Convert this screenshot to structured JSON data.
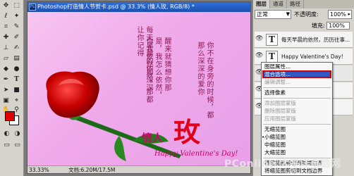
{
  "document": {
    "title": "Photoshop打造情人节贺卡.psd @ 33.3% (情人玫, RGB/8) *",
    "zoom": "33.33%",
    "doc_size": "文档:6.20M/17.5M"
  },
  "canvas": {
    "poem_col1": "每天早晨的依然，那都让你记得",
    "poem_col2": "醒来就猜想你那是，我怎么依然，你我依然那深深",
    "poem_col3": "你不在身旁的时候，都那么深深的爱你",
    "qingren": "情人",
    "mei": "玫",
    "valentine": "Happy Valentine's Day!"
  },
  "layers_panel": {
    "tabs": [
      "图层",
      "通道",
      "路径"
    ],
    "blend_mode": "正常",
    "opacity_label": "不透明度:",
    "opacity_value": "100%",
    "fill_label": "填充:",
    "fill_value": "100%",
    "layers": [
      {
        "name": "每天早晨的依然，历历往事..."
      },
      {
        "name": "Happy Valentine's Day!"
      }
    ]
  },
  "context_menu": {
    "items": [
      {
        "label": "图层属性...",
        "disabled": false
      },
      {
        "label": "混合选项...",
        "disabled": false,
        "selected": true
      },
      {
        "label": "编辑调整...",
        "disabled": true
      },
      {
        "label": "选择像素",
        "disabled": false
      },
      {
        "label": "添加图层蒙版",
        "disabled": true
      },
      {
        "label": "删除图层蒙版",
        "disabled": true
      },
      {
        "label": "应用图层蒙版",
        "disabled": true
      },
      {
        "label": "无缩览图",
        "disabled": false
      },
      {
        "label": "小缩览图",
        "disabled": false,
        "checked": true
      },
      {
        "label": "中缩览图",
        "disabled": false
      },
      {
        "label": "大缩览图",
        "disabled": false
      },
      {
        "label": "将缩览图剪切到图层边界",
        "disabled": false
      },
      {
        "label": "将缩览图剪切到文档边界",
        "disabled": false
      }
    ]
  },
  "watermark": "PConline 太平洋电脑网",
  "colors": {
    "foreground": "#e00000",
    "background": "#ffffff",
    "highlight": "#2f57c2",
    "annotation_box": "#d40000"
  }
}
